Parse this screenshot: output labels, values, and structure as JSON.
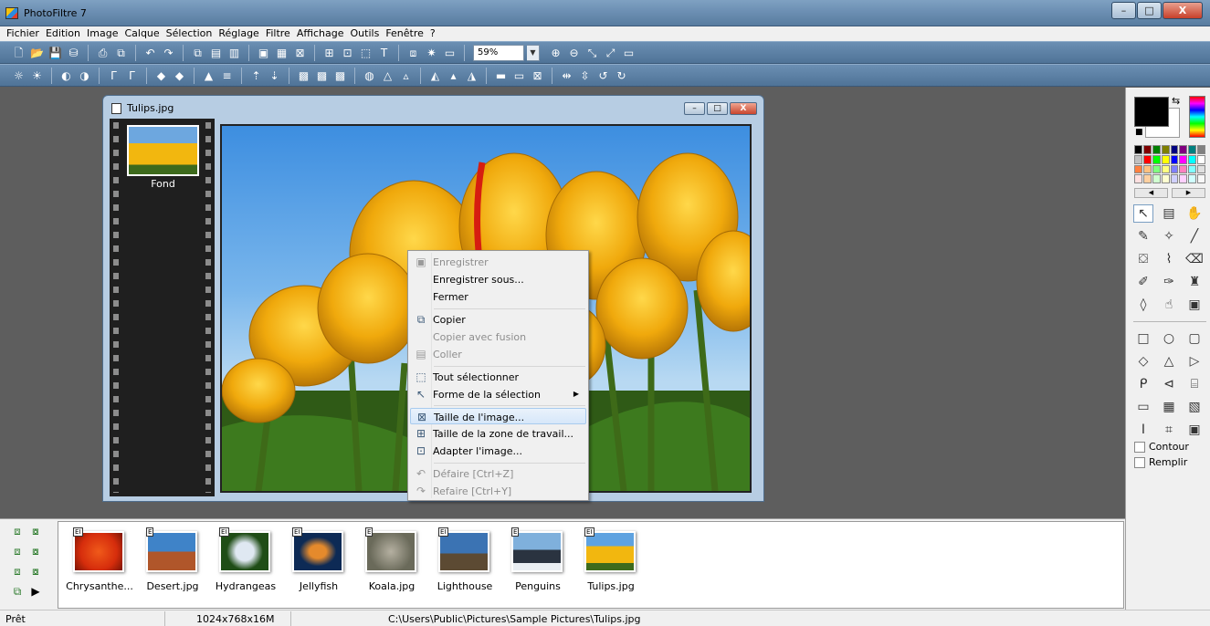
{
  "window": {
    "title": "PhotoFiltre 7",
    "minimize": "–",
    "maximize": "□",
    "close": "X"
  },
  "menu": [
    "Fichier",
    "Edition",
    "Image",
    "Calque",
    "Sélection",
    "Réglage",
    "Filtre",
    "Affichage",
    "Outils",
    "Fenêtre",
    "?"
  ],
  "toolbar": {
    "zoom_value": "59%"
  },
  "document": {
    "title": "Tulips.jpg",
    "layer_label": "Fond"
  },
  "context_menu": [
    {
      "label": "Enregistrer",
      "icon": "save-icon",
      "disabled": true
    },
    {
      "label": "Enregistrer sous...",
      "icon": "",
      "disabled": false
    },
    {
      "label": "Fermer",
      "icon": "",
      "disabled": false
    },
    {
      "label": "Copier",
      "icon": "copy-icon",
      "disabled": false
    },
    {
      "label": "Copier avec fusion",
      "icon": "",
      "disabled": true
    },
    {
      "label": "Coller",
      "icon": "paste-icon",
      "disabled": true
    },
    {
      "label": "Tout sélectionner",
      "icon": "select-all-icon",
      "disabled": false
    },
    {
      "label": "Forme de la sélection",
      "icon": "selection-shape-icon",
      "disabled": false,
      "submenu": true
    },
    {
      "label": "Taille de l'image...",
      "icon": "image-size-icon",
      "disabled": false,
      "highlighted": true
    },
    {
      "label": "Taille de la zone de travail...",
      "icon": "canvas-size-icon",
      "disabled": false
    },
    {
      "label": "Adapter l'image...",
      "icon": "fit-image-icon",
      "disabled": false
    },
    {
      "label": "Défaire [Ctrl+Z]",
      "icon": "undo-icon",
      "disabled": true
    },
    {
      "label": "Refaire [Ctrl+Y]",
      "icon": "redo-icon",
      "disabled": true
    }
  ],
  "right_panel": {
    "contour_label": "Contour",
    "remplir_label": "Remplir"
  },
  "thumbnails": [
    {
      "label": "Chrysanthe...",
      "badge": "EI",
      "colors": [
        "#d62d0c",
        "#f05a1a"
      ]
    },
    {
      "label": "Desert.jpg",
      "badge": "E",
      "colors": [
        "#3f83c8",
        "#b0562a"
      ]
    },
    {
      "label": "Hydrangeas",
      "badge": "EI",
      "colors": [
        "#1f4d16",
        "#dfe8f2"
      ]
    },
    {
      "label": "Jellyfish",
      "badge": "EI",
      "colors": [
        "#0d2a55",
        "#e58a2c"
      ]
    },
    {
      "label": "Koala.jpg",
      "badge": "E",
      "colors": [
        "#6a6a5a",
        "#b5b0a1"
      ]
    },
    {
      "label": "Lighthouse",
      "badge": "EI",
      "colors": [
        "#3b73b3",
        "#5c4a33"
      ]
    },
    {
      "label": "Penguins",
      "badge": "E",
      "colors": [
        "#7fb0dc",
        "#2a3340"
      ]
    },
    {
      "label": "Tulips.jpg",
      "badge": "EI",
      "colors": [
        "#5ea2e0",
        "#f2b70f"
      ]
    }
  ],
  "status": {
    "state": "Prêt",
    "dimensions": "1024x768x16M",
    "path": "C:\\Users\\Public\\Pictures\\Sample Pictures\\Tulips.jpg"
  }
}
